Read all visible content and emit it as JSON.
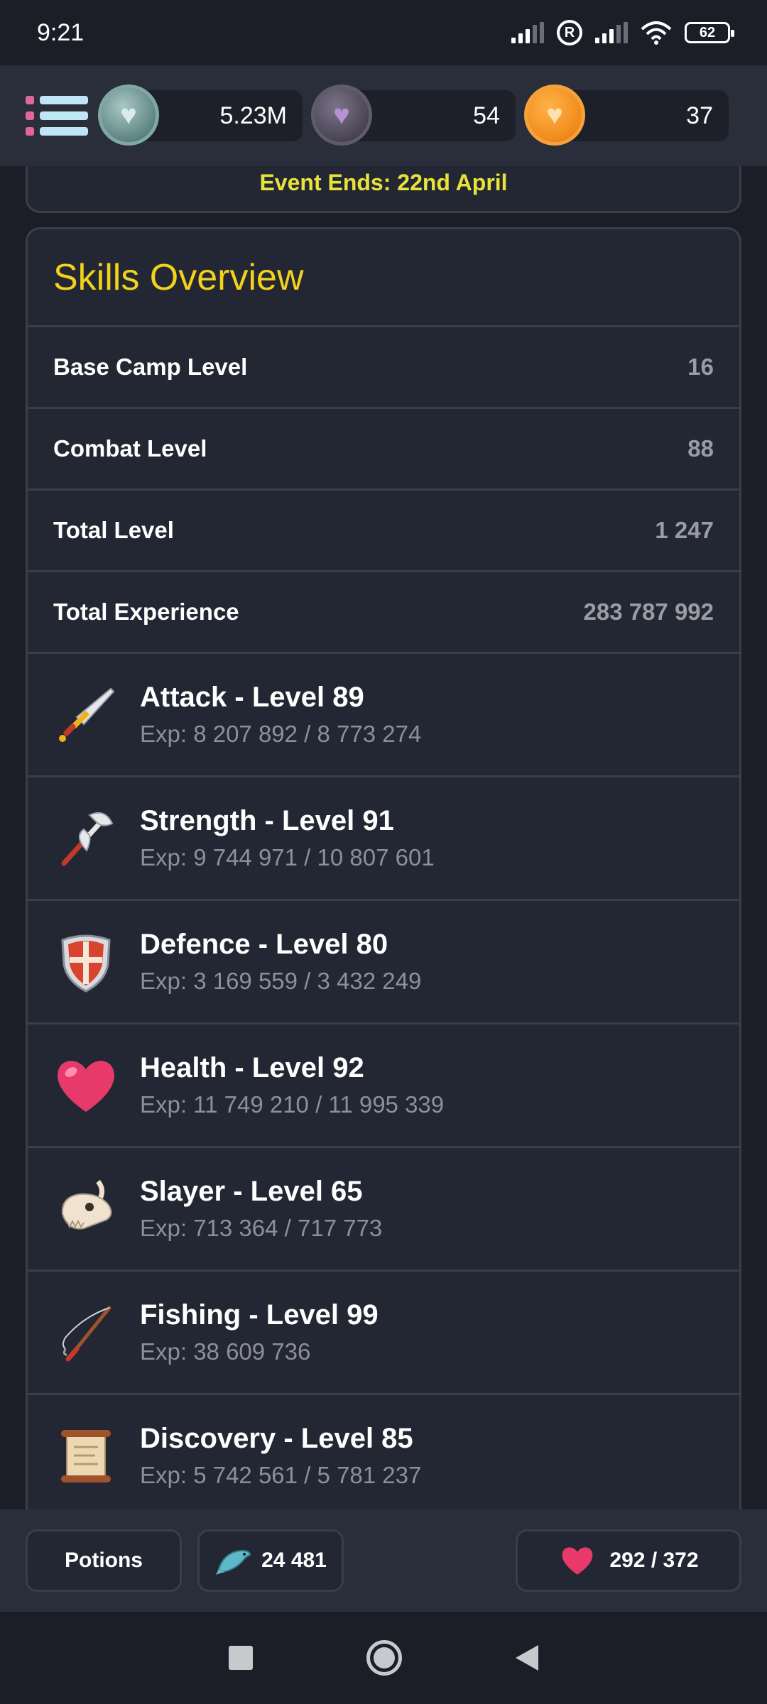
{
  "status_bar": {
    "time": "9:21",
    "battery": "62"
  },
  "header": {
    "currencies": [
      {
        "name": "silver-coin-icon",
        "value": "5.23M"
      },
      {
        "name": "dark-coin-icon",
        "value": "54"
      },
      {
        "name": "gold-coin-icon",
        "value": "37"
      }
    ]
  },
  "event": {
    "text": "Event Ends: 22nd April"
  },
  "skills_overview": {
    "title": "Skills Overview",
    "stats": [
      {
        "label": "Base Camp Level",
        "value": "16"
      },
      {
        "label": "Combat Level",
        "value": "88"
      },
      {
        "label": "Total Level",
        "value": "1 247"
      },
      {
        "label": "Total Experience",
        "value": "283 787 992"
      }
    ],
    "skills": [
      {
        "icon": "sword-icon",
        "title": "Attack - Level 89",
        "exp": "Exp: 8 207 892 / 8 773 274"
      },
      {
        "icon": "axe-icon",
        "title": "Strength - Level 91",
        "exp": "Exp: 9 744 971 / 10 807 601"
      },
      {
        "icon": "shield-icon",
        "title": "Defence - Level 80",
        "exp": "Exp: 3 169 559 / 3 432 249"
      },
      {
        "icon": "heart-icon",
        "title": "Health - Level 92",
        "exp": "Exp: 11 749 210 / 11 995 339"
      },
      {
        "icon": "dragon-skull-icon",
        "title": "Slayer - Level 65",
        "exp": "Exp: 713 364 / 717 773"
      },
      {
        "icon": "fishing-rod-icon",
        "title": "Fishing - Level 99",
        "exp": "Exp: 38 609 736"
      },
      {
        "icon": "scroll-icon",
        "title": "Discovery - Level 85",
        "exp": "Exp: 5 742 561 / 5 781 237"
      }
    ]
  },
  "bottom_bar": {
    "potions_label": "Potions",
    "fish_count": "24 481",
    "health": "292 / 372"
  },
  "colors": {
    "title_yellow": "#f2d21a",
    "event_yellow": "#e8e23a",
    "background": "#1b1e27"
  }
}
